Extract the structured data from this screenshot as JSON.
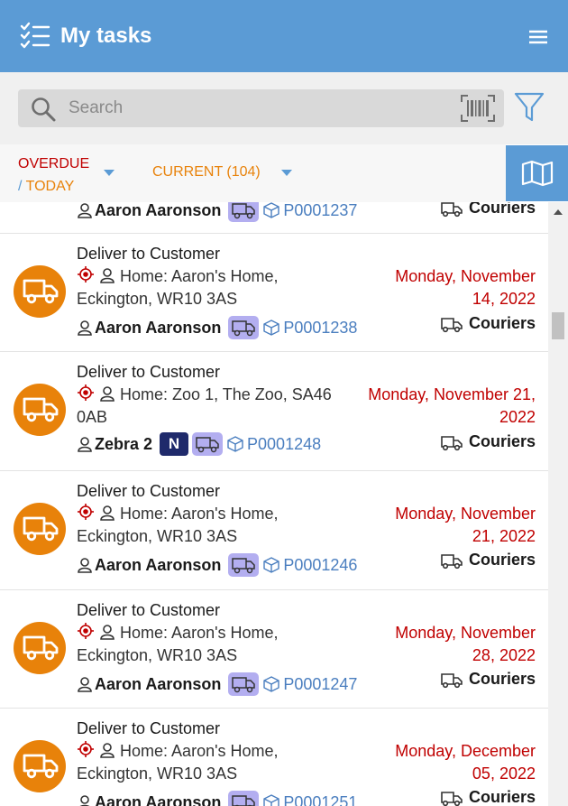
{
  "header": {
    "title": "My tasks",
    "icon": "task-list-icon",
    "menu_icon": "hamburger-menu-icon"
  },
  "search": {
    "placeholder": "Search",
    "value": "",
    "icon": "search-icon",
    "barcode_icon": "barcode-icon",
    "filter_icon": "filter-icon"
  },
  "tabs": {
    "overdue_label": "OVERDUE",
    "slash": "/ ",
    "today_label": "TODAY",
    "current_label": "CURRENT (104)",
    "map_icon": "map-icon"
  },
  "colors": {
    "accent": "#5b9bd5",
    "orange": "#e8820a",
    "red": "#c00000",
    "badge": "#b3aef0",
    "navy": "#1f2a6b"
  },
  "tasks": [
    {
      "title": "",
      "address": "",
      "assignee": "Aaron Aaronson",
      "badge": "",
      "reference": "P0001237",
      "date": "",
      "type": "Couriers"
    },
    {
      "title": "Deliver to Customer",
      "address": "Home: Aaron's Home, Eckington, WR10 3AS",
      "assignee": "Aaron Aaronson",
      "badge": "",
      "reference": "P0001238",
      "date": "Monday, November 14, 2022",
      "type": "Couriers"
    },
    {
      "title": "Deliver to Customer",
      "address": "Home: Zoo 1, The Zoo, SA46 0AB",
      "assignee": "Zebra 2",
      "badge": "N",
      "reference": "P0001248",
      "date": "Monday, November 21, 2022",
      "type": "Couriers"
    },
    {
      "title": "Deliver to Customer",
      "address": "Home: Aaron's Home, Eckington, WR10 3AS",
      "assignee": "Aaron Aaronson",
      "badge": "",
      "reference": "P0001246",
      "date": "Monday, November 21, 2022",
      "type": "Couriers"
    },
    {
      "title": "Deliver to Customer",
      "address": "Home: Aaron's Home, Eckington, WR10 3AS",
      "assignee": "Aaron Aaronson",
      "badge": "",
      "reference": "P0001247",
      "date": "Monday, November 28, 2022",
      "type": "Couriers"
    },
    {
      "title": "Deliver to Customer",
      "address": "Home: Aaron's Home, Eckington, WR10 3AS",
      "assignee": "Aaron Aaronson",
      "badge": "",
      "reference": "P0001251",
      "date": "Monday, December 05, 2022",
      "type": "Couriers"
    }
  ]
}
